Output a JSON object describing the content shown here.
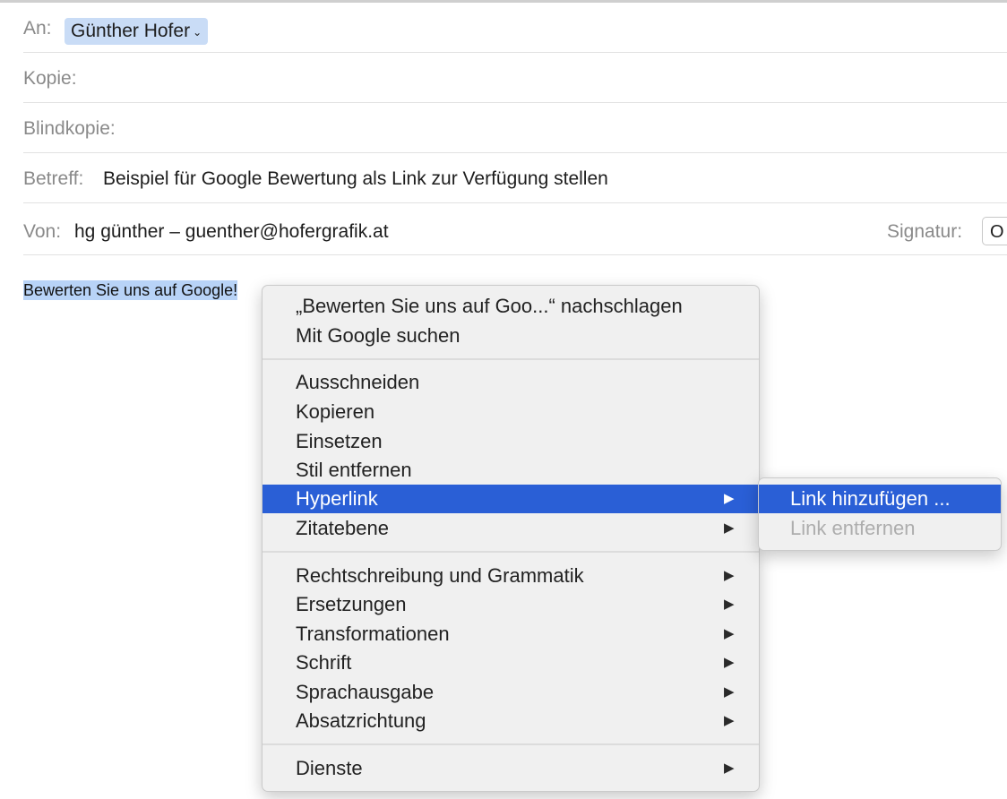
{
  "header": {
    "to_label": "An:",
    "to_recipient": "Günther Hofer",
    "cc_label": "Kopie:",
    "bcc_label": "Blindkopie:",
    "subject_label": "Betreff:",
    "subject_value": "Beispiel für Google Bewertung als Link zur Verfügung stellen",
    "from_label": "Von:",
    "from_value": "hg günther – guenther@hofergrafik.at",
    "signature_label": "Signatur:",
    "signature_value": "O"
  },
  "body": {
    "selected_text": "Bewerten Sie uns auf Google!"
  },
  "context_menu": {
    "lookup": "„Bewerten Sie uns auf Goo...“ nachschlagen",
    "google_search": "Mit Google suchen",
    "cut": "Ausschneiden",
    "copy": "Kopieren",
    "paste": "Einsetzen",
    "remove_style": "Stil entfernen",
    "hyperlink": "Hyperlink",
    "quote_level": "Zitatebene",
    "spelling": "Rechtschreibung und Grammatik",
    "substitutions": "Ersetzungen",
    "transformations": "Transformationen",
    "font": "Schrift",
    "speech": "Sprachausgabe",
    "writing_direction": "Absatzrichtung",
    "services": "Dienste",
    "arrow_glyph": "▶"
  },
  "submenu": {
    "add_link": "Link hinzufügen ...",
    "remove_link": "Link entfernen"
  },
  "colors": {
    "highlight": "#2a5fd6",
    "selection": "#b8d3f7",
    "chip": "#c9dcf6"
  }
}
